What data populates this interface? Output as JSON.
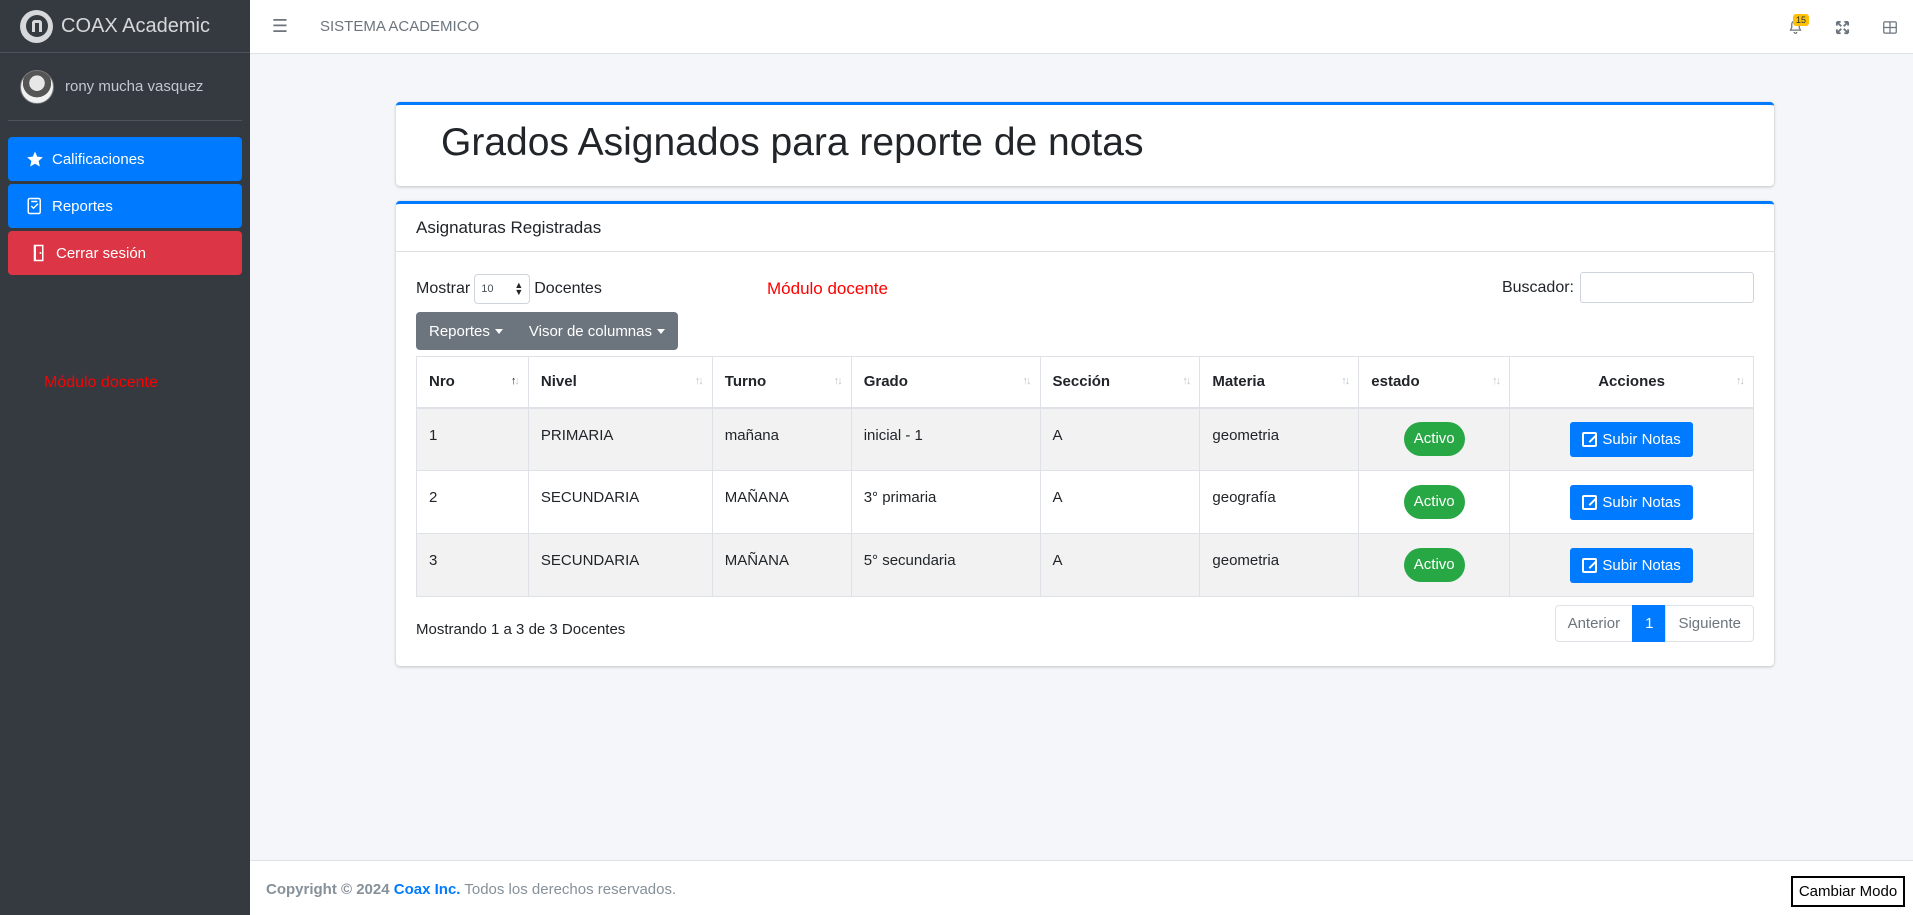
{
  "sidebar": {
    "brand": "COAX Academic",
    "user_name": "rony mucha vasquez",
    "items": [
      {
        "label": "Calificaciones",
        "icon": "star-icon"
      },
      {
        "label": "Reportes",
        "icon": "checklist-icon"
      },
      {
        "label": "Cerrar sesión",
        "icon": "door-icon"
      }
    ],
    "module_label": "Módulo docente"
  },
  "topbar": {
    "title": "SISTEMA ACADEMICO",
    "notification_count": "15"
  },
  "main": {
    "page_title": "Grados Asignados para reporte de notas",
    "module_label": "Módulo docente",
    "card_title": "Asignaturas Registradas",
    "length": {
      "prefix": "Mostrar",
      "value": "10",
      "suffix": "Docentes"
    },
    "search_label": "Buscador:",
    "buttons": {
      "reports": "Reportes",
      "columns": "Visor de columnas"
    },
    "columns": [
      "Nro",
      "Nivel",
      "Turno",
      "Grado",
      "Sección",
      "Materia",
      "estado",
      "Acciones"
    ],
    "rows": [
      {
        "nro": "1",
        "nivel": "PRIMARIA",
        "turno": "mañana",
        "grado": "inicial - 1",
        "seccion": "A",
        "materia": "geometria",
        "estado": "Activo",
        "accion": "Subir Notas"
      },
      {
        "nro": "2",
        "nivel": "SECUNDARIA",
        "turno": "MAÑANA",
        "grado": "3° primaria",
        "seccion": "A",
        "materia": "geografía",
        "estado": "Activo",
        "accion": "Subir Notas"
      },
      {
        "nro": "3",
        "nivel": "SECUNDARIA",
        "turno": "MAÑANA",
        "grado": "5° secundaria",
        "seccion": "A",
        "materia": "geometria",
        "estado": "Activo",
        "accion": "Subir Notas"
      }
    ],
    "info": "Mostrando 1 a 3 de 3 Docentes",
    "pagination": {
      "prev": "Anterior",
      "current": "1",
      "next": "Siguiente"
    }
  },
  "footer": {
    "copyright": "Copyright © 2024",
    "company": "Coax Inc.",
    "rights": "Todos los derechos reservados.",
    "mode_button": "Cambiar Modo"
  },
  "colors": {
    "primary": "#007bff",
    "danger": "#dc3545",
    "success": "#28a745",
    "sidebar": "#343a40"
  }
}
